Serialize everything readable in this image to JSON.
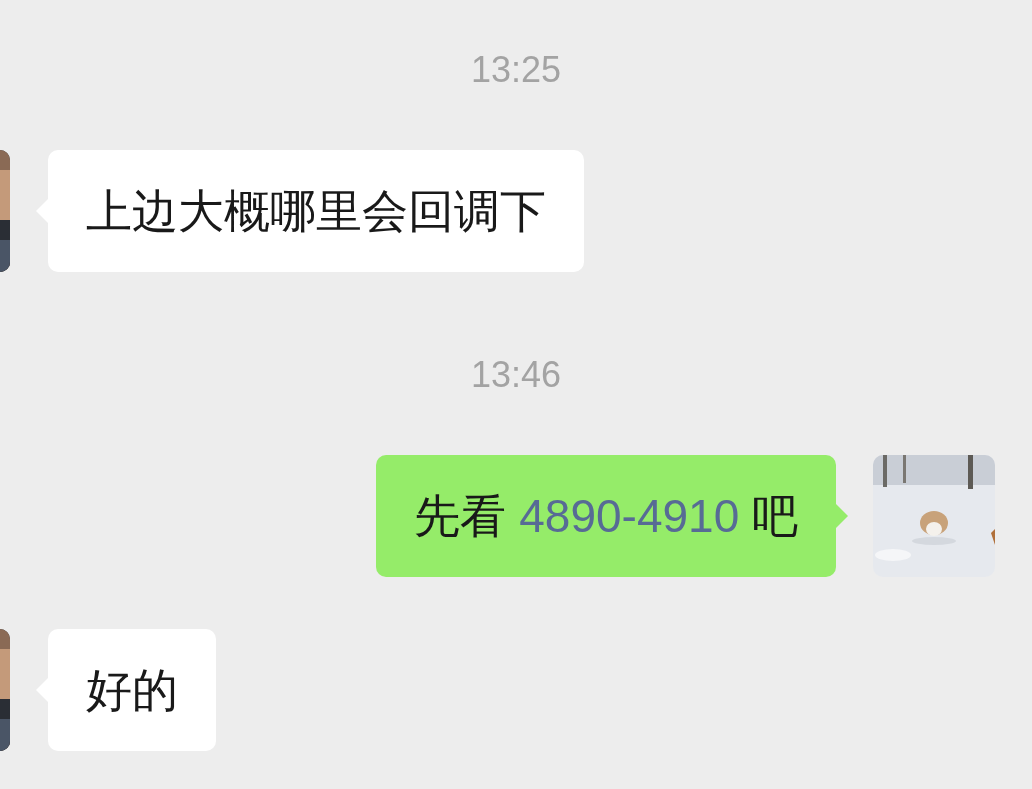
{
  "chat": [
    {
      "kind": "time",
      "text": "13:25"
    },
    {
      "kind": "received",
      "segments": [
        {
          "kind": "text",
          "text": "上边大概哪里会回调下"
        }
      ]
    },
    {
      "kind": "time",
      "text": "13:46"
    },
    {
      "kind": "sent",
      "segments": [
        {
          "kind": "text",
          "text": "先看 "
        },
        {
          "kind": "link",
          "text": "4890-4910"
        },
        {
          "kind": "text",
          "text": " 吧"
        }
      ]
    },
    {
      "kind": "received",
      "segments": [
        {
          "kind": "text",
          "text": "好的"
        }
      ]
    }
  ]
}
